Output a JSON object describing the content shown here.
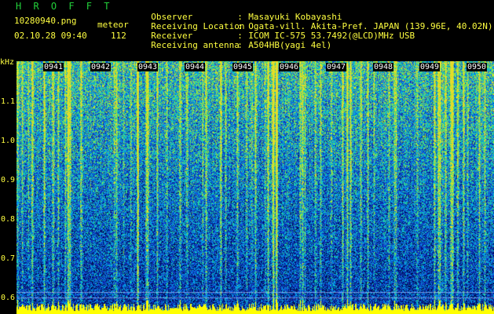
{
  "header": {
    "title": "H R O F F T",
    "filename": "10280940.png",
    "meteor_label": "meteor",
    "datetime": "02.10.28 09:40",
    "meteor_count": "112"
  },
  "info": [
    {
      "key": "Observer",
      "value": "Masayuki Kobayashi"
    },
    {
      "key": "Receiving Location",
      "value": "Ogata-vill. Akita-Pref. JAPAN (139.96E, 40.02N)"
    },
    {
      "key": "Receiver",
      "value": "ICOM IC-575 53.7492(@LCD)MHz USB"
    },
    {
      "key": "Receiving antenna",
      "value": "A504HB(yagi 4el)"
    }
  ],
  "axes": {
    "y_unit": "kHz",
    "y_ticks": [
      "1.1",
      "1.0",
      "0.9",
      "0.8",
      "0.7",
      "0.6"
    ],
    "x_ticks": [
      "0941",
      "0942",
      "0943",
      "0944",
      "0945",
      "0946",
      "0947",
      "0948",
      "0949",
      "0950"
    ]
  },
  "colors": {
    "text_yellow": "#ffff40",
    "title_green": "#22d03a",
    "background": "#000000"
  }
}
